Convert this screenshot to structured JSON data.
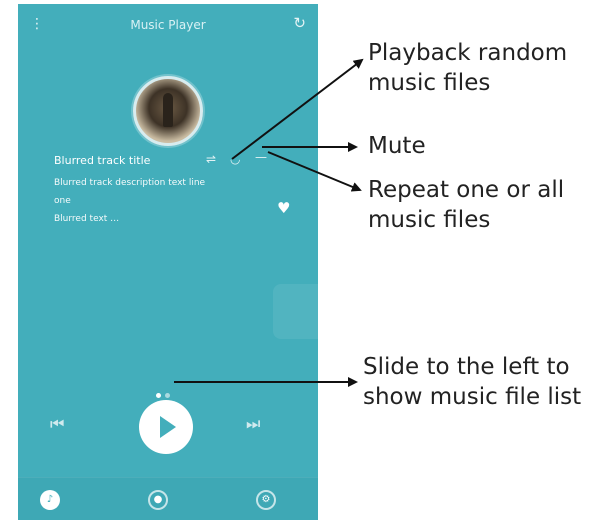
{
  "app": {
    "title": "Music Player",
    "menu_icon": "menu-icon",
    "refresh_icon": "refresh-icon"
  },
  "track": {
    "title": "Blurred track title",
    "description": "Blurred track description text line one",
    "description2": "Blurred text …"
  },
  "controls": {
    "shuffle_icon": "shuffle-icon",
    "mute_icon": "mute-icon",
    "repeat_icon": "repeat-icon",
    "favorite_icon": "heart-icon",
    "prev_icon": "previous-icon",
    "play_icon": "play-icon",
    "next_icon": "next-icon"
  },
  "pager": {
    "pages": 2,
    "active": 1
  },
  "bottom_nav": [
    {
      "icon": "music-icon",
      "active": true
    },
    {
      "icon": "user-icon",
      "active": false
    },
    {
      "icon": "settings-icon",
      "active": false
    }
  ],
  "annotations": {
    "shuffle": [
      "Playback random",
      "music files"
    ],
    "mute": [
      "Mute"
    ],
    "repeat": [
      "Repeat one or all",
      "music files"
    ],
    "slide": [
      "Slide to the left to",
      "show music file list"
    ]
  },
  "colors": {
    "screen_bg": "#43aebb",
    "text": "#222222",
    "accent": "#ffffff"
  }
}
